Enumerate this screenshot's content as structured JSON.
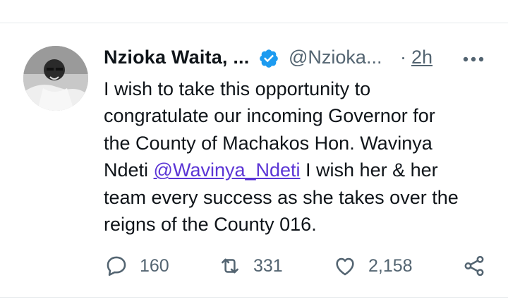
{
  "tweet": {
    "display_name": "Nzioka Waita, ...",
    "handle": "@Nzioka...",
    "separator": "·",
    "time": "2h",
    "text_before": "I wish to take this opportunity to\ncongratulate our incoming Governor for\nthe County of Machakos Hon. Wavinya\nNdeti ",
    "mention": "@Wavinya_Ndeti",
    "text_after": " I wish her & her\nteam every success as she takes over the\nreigns of the County 016."
  },
  "actions": {
    "replies": "160",
    "retweets": "331",
    "likes": "2,158"
  },
  "colors": {
    "verified": "#1d9bf0",
    "mention": "#5b35d5",
    "muted": "#536471"
  },
  "icons": [
    "verified-badge-icon",
    "more-icon",
    "reply-icon",
    "retweet-icon",
    "like-icon",
    "share-icon"
  ]
}
